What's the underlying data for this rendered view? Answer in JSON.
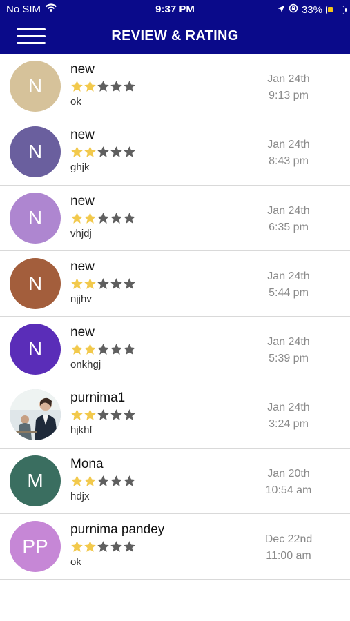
{
  "status_bar": {
    "carrier": "No SIM",
    "time": "9:37 PM",
    "battery": "33%",
    "battery_level": 0.33
  },
  "header": {
    "title": "REVIEW & RATING"
  },
  "colors": {
    "nav_background": "#0a0a8a",
    "star_filled": "#f2c94c",
    "star_empty": "#5f5f5f"
  },
  "reviews": [
    {
      "avatar_text": "N",
      "avatar_color": "#d6c29a",
      "name": "new",
      "rating": 2,
      "max_rating": 5,
      "comment": "ok",
      "date": "Jan 24th",
      "time": "9:13 pm"
    },
    {
      "avatar_text": "N",
      "avatar_color": "#6a5f9e",
      "name": "new",
      "rating": 2,
      "max_rating": 5,
      "comment": "ghjk",
      "date": "Jan 24th",
      "time": "8:43 pm"
    },
    {
      "avatar_text": "N",
      "avatar_color": "#ae86d0",
      "name": "new",
      "rating": 2,
      "max_rating": 5,
      "comment": "vhjdj",
      "date": "Jan 24th",
      "time": "6:35 pm"
    },
    {
      "avatar_text": "N",
      "avatar_color": "#a35e3c",
      "name": "new",
      "rating": 2,
      "max_rating": 5,
      "comment": "njjhv",
      "date": "Jan 24th",
      "time": "5:44 pm"
    },
    {
      "avatar_text": "N",
      "avatar_color": "#5a2db8",
      "name": "new",
      "rating": 2,
      "max_rating": 5,
      "comment": "onkhgj",
      "date": "Jan 24th",
      "time": "5:39 pm"
    },
    {
      "avatar_text": "",
      "avatar_color": "",
      "avatar_photo": true,
      "name": "purnima1",
      "rating": 2,
      "max_rating": 5,
      "comment": "hjkhf",
      "date": "Jan 24th",
      "time": "3:24 pm"
    },
    {
      "avatar_text": "M",
      "avatar_color": "#3a6e60",
      "name": "Mona",
      "rating": 2,
      "max_rating": 5,
      "comment": "hdjx",
      "date": "Jan 20th",
      "time": "10:54 am"
    },
    {
      "avatar_text": "PP",
      "avatar_color": "#c687d6",
      "name": "purnima pandey",
      "rating": 2,
      "max_rating": 5,
      "comment": "ok",
      "date": "Dec 22nd",
      "time": "11:00 am"
    }
  ]
}
